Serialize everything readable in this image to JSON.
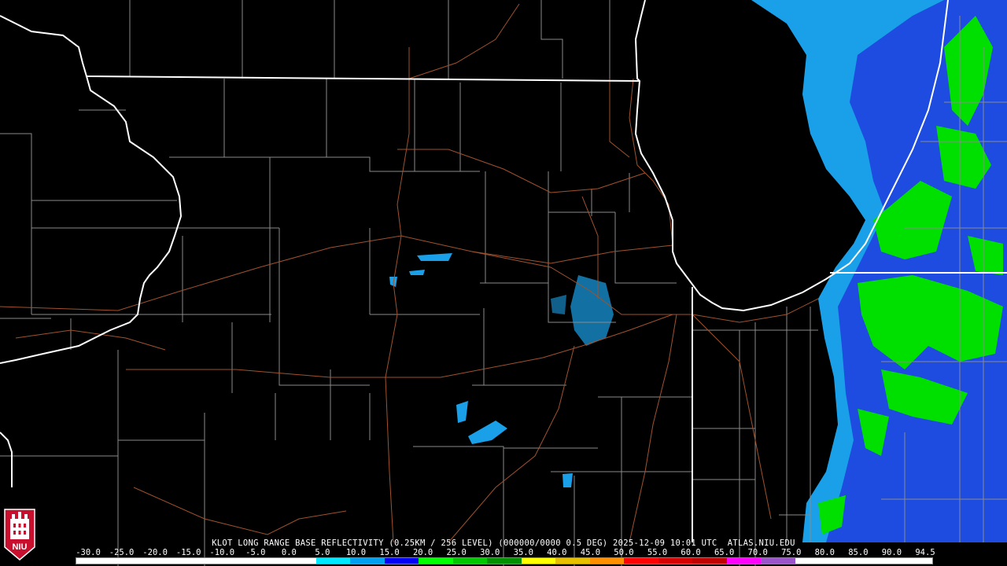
{
  "product": {
    "title": "KLOT LONG RANGE BASE REFLECTIVITY (0.25KM / 256 LEVEL) (000000/0000 0.5 DEG) 2025-12-09 10:01 UTC  ATLAS.NIU.EDU"
  },
  "logo": {
    "text": "NIU",
    "color": "#c8102e"
  },
  "scale": {
    "labels": [
      "-30.0",
      "-25.0",
      "-20.0",
      "-15.0",
      "-10.0",
      "-5.0",
      "0.0",
      "5.0",
      "10.0",
      "15.0",
      "20.0",
      "25.0",
      "30.0",
      "35.0",
      "40.0",
      "45.0",
      "50.0",
      "55.0",
      "60.0",
      "65.0",
      "70.0",
      "75.0",
      "80.0",
      "85.0",
      "90.0",
      "94.5"
    ],
    "colors": [
      "#ffffff",
      "#ffffff",
      "#ffffff",
      "#ffffff",
      "#ffffff",
      "#ffffff",
      "#ffffff",
      "#00e8ff",
      "#00a0f0",
      "#0000f6",
      "#00ff00",
      "#00c800",
      "#009000",
      "#ffff00",
      "#e7c000",
      "#ff9000",
      "#ff0000",
      "#d60000",
      "#c00000",
      "#ff00ff",
      "#9955c9",
      "#ffffff",
      "#ffffff",
      "#ffffff",
      "#ffffff"
    ]
  },
  "colors": {
    "state_border": "#ffffff",
    "county_border": "#8a8a8a",
    "highway": "#a0522d",
    "echo_light": "#1aa0e8",
    "echo_mid": "#0000e0",
    "echo_green": "#00e000"
  }
}
